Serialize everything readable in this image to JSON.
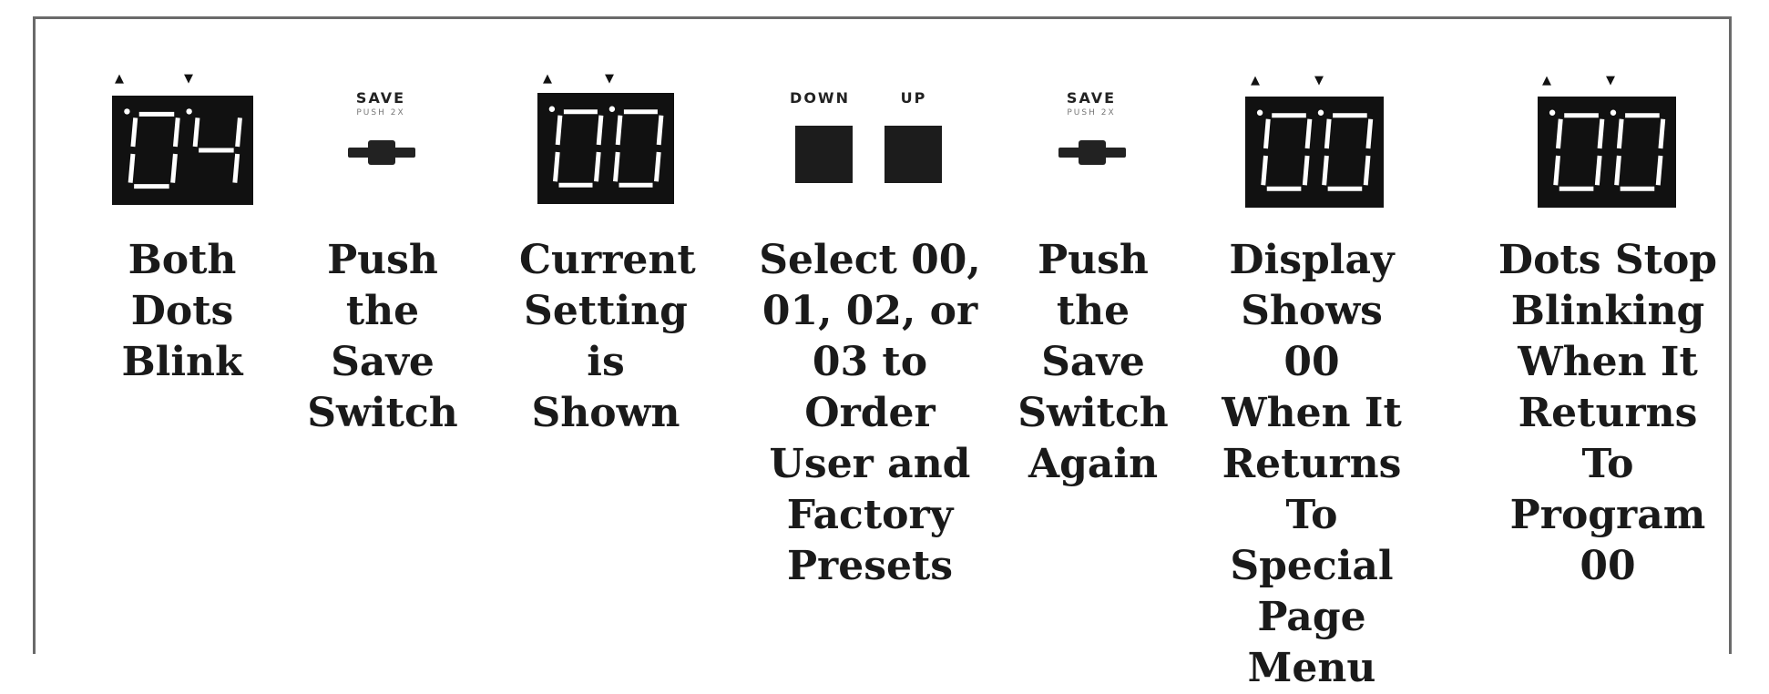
{
  "steps": [
    {
      "display": "04",
      "caption": [
        "Both",
        "Dots",
        "Blink"
      ]
    },
    {
      "switch_label": "SAVE",
      "switch_sub": "PUSH 2X",
      "caption": [
        "Push",
        "the",
        "Save",
        "Switch"
      ]
    },
    {
      "display": "00",
      "caption": [
        "Current",
        "Setting",
        "is",
        "Shown"
      ]
    },
    {
      "buttons": [
        "DOWN",
        "UP"
      ],
      "caption": [
        "Select 00,",
        "01, 02, or",
        "03 to",
        "Order",
        "User and",
        "Factory",
        "Presets"
      ]
    },
    {
      "switch_label": "SAVE",
      "switch_sub": "PUSH 2X",
      "caption": [
        "Push",
        "the",
        "Save",
        "Switch",
        "Again"
      ]
    },
    {
      "display": "00",
      "caption": [
        "Display",
        "Shows 00",
        "When It",
        "Returns",
        "To",
        "Special",
        "Page",
        "Menu"
      ]
    },
    {
      "display": "00",
      "caption": [
        "Dots Stop",
        "Blinking",
        "When  It",
        "Returns",
        "To",
        "Program",
        "00"
      ]
    }
  ],
  "icons": {
    "dot_left": "up-triangle-icon",
    "dot_right": "down-triangle-icon"
  }
}
